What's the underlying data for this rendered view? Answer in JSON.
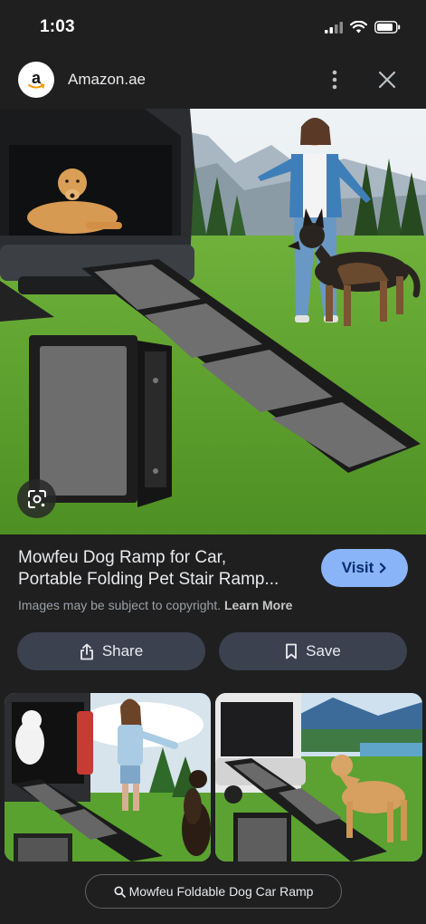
{
  "status_bar": {
    "time": "1:03"
  },
  "header": {
    "site_name": "Amazon.ae",
    "logo_letter": "a"
  },
  "product": {
    "title_line1": "Mowfeu Dog Ramp for Car,",
    "title_line2": "Portable Folding Pet Stair Ramp..."
  },
  "visit_label": "Visit",
  "copyright": {
    "note": "Images may be subject to copyright.",
    "learn_more": "Learn More"
  },
  "actions": {
    "share_label": "Share",
    "save_label": "Save"
  },
  "search_chip": {
    "label": "Mowfeu Foldable Dog Car Ramp"
  },
  "colors": {
    "background": "#1f1f1f",
    "accent": "#8ab4f8",
    "button_bg": "#3c4150",
    "amazon_orange": "#ff9900"
  },
  "icons": [
    "signal-icon",
    "wifi-icon",
    "battery-icon",
    "more-vert-icon",
    "close-icon",
    "lens-icon",
    "chevron-right-icon",
    "share-icon",
    "bookmark-icon",
    "search-icon"
  ]
}
